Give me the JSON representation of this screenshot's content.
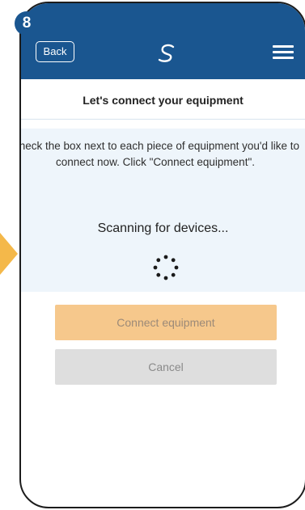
{
  "step": {
    "number": "8"
  },
  "header": {
    "back_label": "Back",
    "logo_icon": "s-swirl-logo-icon",
    "menu_icon": "hamburger-menu-icon"
  },
  "page": {
    "title": "Let's connect your equipment",
    "instructions": "Check the box next to each piece of equipment you'd like to connect now. Click \"Connect equipment\".",
    "status": "Scanning for devices...",
    "spinner_icon": "loading-spinner-icon"
  },
  "actions": {
    "connect_label": "Connect equipment",
    "cancel_label": "Cancel"
  },
  "colors": {
    "header_blue": "#1a5690",
    "accent_orange": "#f4b84a",
    "connect_disabled": "#f6c88c",
    "cancel_disabled": "#dedede",
    "panel_background": "#eef5fb"
  }
}
